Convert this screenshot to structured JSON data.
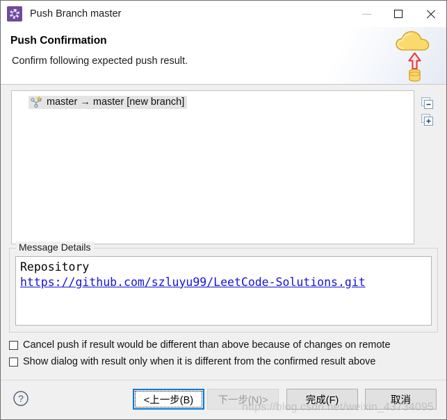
{
  "window": {
    "title": "Push Branch master",
    "title_icon": "git-push-icon",
    "controls": {
      "minimize": "minimize-icon",
      "maximize": "maximize-icon",
      "close": "close-icon"
    }
  },
  "header": {
    "title": "Push Confirmation",
    "subtitle": "Confirm following expected push result.",
    "banner_icon": "cloud-upload-icon"
  },
  "tree": {
    "items": [
      {
        "icon": "new-branch-icon",
        "label": "master → master [new branch]",
        "selected": true
      }
    ],
    "tools": [
      {
        "name": "collapse-all-icon",
        "label": "−"
      },
      {
        "name": "expand-all-icon",
        "label": "+"
      }
    ]
  },
  "message_details": {
    "legend": "Message Details",
    "heading": "Repository",
    "url": "https://github.com/szluyu99/LeetCode-Solutions.git"
  },
  "options": [
    {
      "label": "Cancel push if result would be different than above because of changes on remote",
      "checked": false
    },
    {
      "label": "Show dialog with result only when it is different from the confirmed result above",
      "checked": false
    }
  ],
  "footer": {
    "help": "?",
    "buttons": {
      "back": "<上一步(B)",
      "next": "下一步(N)>",
      "finish": "完成(F)",
      "cancel": "取消"
    }
  },
  "watermark": "https://blog.csdn.net/weixin_43734095",
  "colors": {
    "accent": "#0078d7",
    "link": "#1414d8",
    "title_icon_bg": "#6f4a9b",
    "cloud": "#f7d66a",
    "arrow": "#e03a3a"
  }
}
